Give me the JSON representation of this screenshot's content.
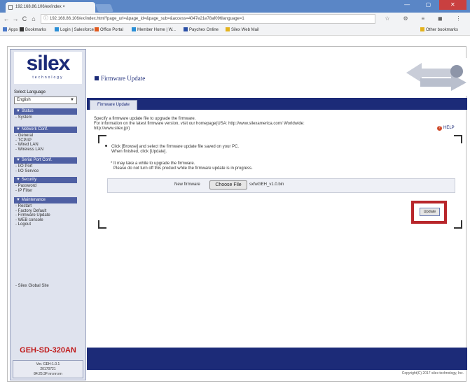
{
  "browser": {
    "tab_title": "192.168.86.106/ex/index ×",
    "url": "192.168.86.106/ex/index.html?page_url=&page_id=&page_sub=&access=4047e21e78af096language=1",
    "nav": {
      "back": "←",
      "forward": "→",
      "reload": "C",
      "home": "⌂"
    },
    "window_controls": {
      "minimize": "—",
      "maximize": "▢",
      "close": "✕"
    },
    "toolbar_icons": [
      "☆",
      "⚙",
      "≡",
      "◼",
      "⋮"
    ],
    "bookmarks": [
      {
        "label": "Apps",
        "color": "#4a78c8"
      },
      {
        "label": "Bookmarks",
        "color": "#333333"
      },
      {
        "label": "Login | Salesforce",
        "color": "#2a8fd6"
      },
      {
        "label": "Office Portal",
        "color": "#e05a1e"
      },
      {
        "label": "Member Home | W...",
        "color": "#2a8fd6"
      },
      {
        "label": "Paychex Online",
        "color": "#2a4fa6"
      },
      {
        "label": "Silex Web Mail",
        "color": "#e3b21c"
      }
    ],
    "other_bookmarks": "Other bookmarks"
  },
  "sidebar": {
    "logo": "silex",
    "logo_sub": "technology",
    "select_language_label": "Select Language",
    "language": "English",
    "sections": [
      {
        "title": "▼ Status",
        "items": [
          "- System"
        ]
      },
      {
        "title": "▼ Network Conf.",
        "items": [
          "- General",
          "- TCP/IP",
          "- Wired LAN",
          "- Wireless LAN"
        ]
      },
      {
        "title": "▼ Serial Port Conf.",
        "items": [
          "- I/O Port",
          "- I/O Service"
        ]
      },
      {
        "title": "▼ Security",
        "items": [
          "- Password",
          "- IP Filter"
        ]
      },
      {
        "title": "▼ Maintenance",
        "items": [
          "- Restart",
          "- Factory Default",
          "- Firmware Update",
          "- WEB console",
          "- Logout"
        ]
      }
    ],
    "global_site_link": "- Silex Global Site",
    "model": "GEH-SD-320AN",
    "version_lines": [
      "Ver. GEH-1.0.1",
      "20170721",
      "84:25:3F:nn:nn:nn"
    ]
  },
  "main": {
    "title": "Firmware Update",
    "tab": "Firmware Update",
    "description": [
      "Specify a firmware update file to upgrade the firmware.",
      "For information on the latest firmware version, visit our homepage(USA: http://www.silexamerica.com/  Worldwide:",
      "http://www.silex.jp/)"
    ],
    "help": "HELP",
    "step1_line1": "Click [Browse] and select the firmware update file saved on your PC.",
    "step1_line2": "When finished, click [Update].",
    "note_line1": "* It may take a while to upgrade the firmware.",
    "note_line2": "Please do not turn off this product while the firmware update is in progress.",
    "new_firmware_label": "New firmware",
    "choose_file": "Choose File",
    "file_name": "sxfwGEH_v1.0.bin",
    "update_button": "Update",
    "copyright": "Copyright(C) 2017 silex technology, Inc."
  },
  "colors": {
    "brand_navy": "#1c2b78",
    "highlight_red": "#b8262b",
    "model_red": "#c01818",
    "sidebar_bg": "#dfe3ee"
  }
}
